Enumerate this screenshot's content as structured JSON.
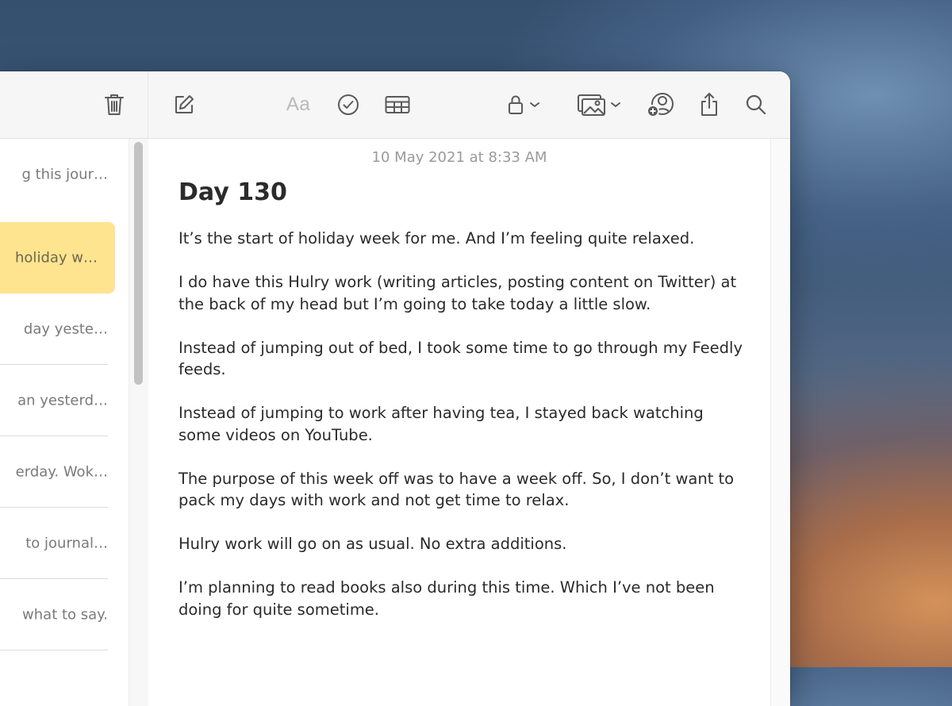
{
  "note": {
    "date": "10 May 2021 at 8:33 AM",
    "title": "Day 130",
    "paragraphs": [
      "It’s the start of holiday week for me. And I’m feeling quite relaxed.",
      "I do have this Hulry work (writing articles, posting content on Twitter) at the back of my head but I’m going to take today a little slow.",
      "Instead of jumping out of bed, I took some time to go through my Feedly feeds.",
      "Instead of jumping to work after having tea, I stayed back watching some videos on YouTube.",
      "The purpose of this week off was to have a week off. So, I don’t want to pack my days with work and not get time to relax.",
      "Hulry work will go on as usual. No extra additions.",
      "I’m planning to read books also during this time. Which I’ve not been doing for quite sometime."
    ]
  },
  "toolbar": {
    "format_label": "Aa",
    "icons": [
      "trash-icon",
      "compose-icon",
      "checklist-icon",
      "table-icon",
      "lock-icon",
      "media-icon",
      "add-people-icon",
      "share-icon",
      "search-icon"
    ]
  },
  "sidebar": {
    "items": [
      {
        "snippet": "g this jour…",
        "selected": false
      },
      {
        "snippet": "holiday w…",
        "selected": true
      },
      {
        "snippet": "day yeste…",
        "selected": false
      },
      {
        "snippet": "an yesterd…",
        "selected": false
      },
      {
        "snippet": "erday. Wok…",
        "selected": false
      },
      {
        "snippet": "to journal…",
        "selected": false
      },
      {
        "snippet": "what to say.",
        "selected": false
      }
    ]
  },
  "colors": {
    "selected_note": "#fee48f",
    "toolbar_bg": "#f6f6f6",
    "text": "#2a2a2a"
  }
}
